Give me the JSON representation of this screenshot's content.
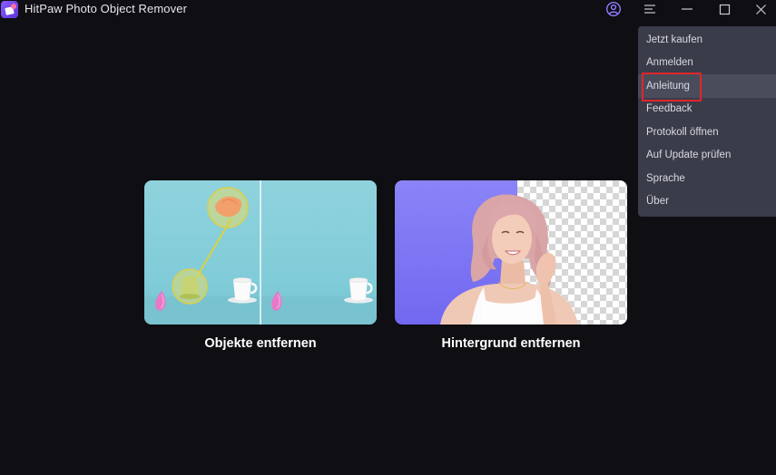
{
  "app": {
    "title": "HitPaw Photo Object Remover",
    "logo_icon": "hitpaw-logo-icon",
    "accent": "#7b5cf5"
  },
  "titlebar": {
    "account_icon": "user-circle-icon",
    "menu_icon": "hamburger-menu-icon",
    "minimize_icon": "minimize-icon",
    "maximize_icon": "maximize-icon",
    "close_icon": "close-icon"
  },
  "menu": {
    "items": [
      {
        "label": "Jetzt kaufen"
      },
      {
        "label": "Anmelden"
      },
      {
        "label": "Anleitung"
      },
      {
        "label": "Feedback"
      },
      {
        "label": "Protokoll öffnen"
      },
      {
        "label": "Auf Update prüfen"
      },
      {
        "label": "Sprache"
      },
      {
        "label": "Über"
      }
    ],
    "highlighted_item": "Anleitung",
    "highlight_color": "#e0262b"
  },
  "modes": [
    {
      "label": "Objekte entfernen"
    },
    {
      "label": "Hintergrund entfernen"
    }
  ]
}
